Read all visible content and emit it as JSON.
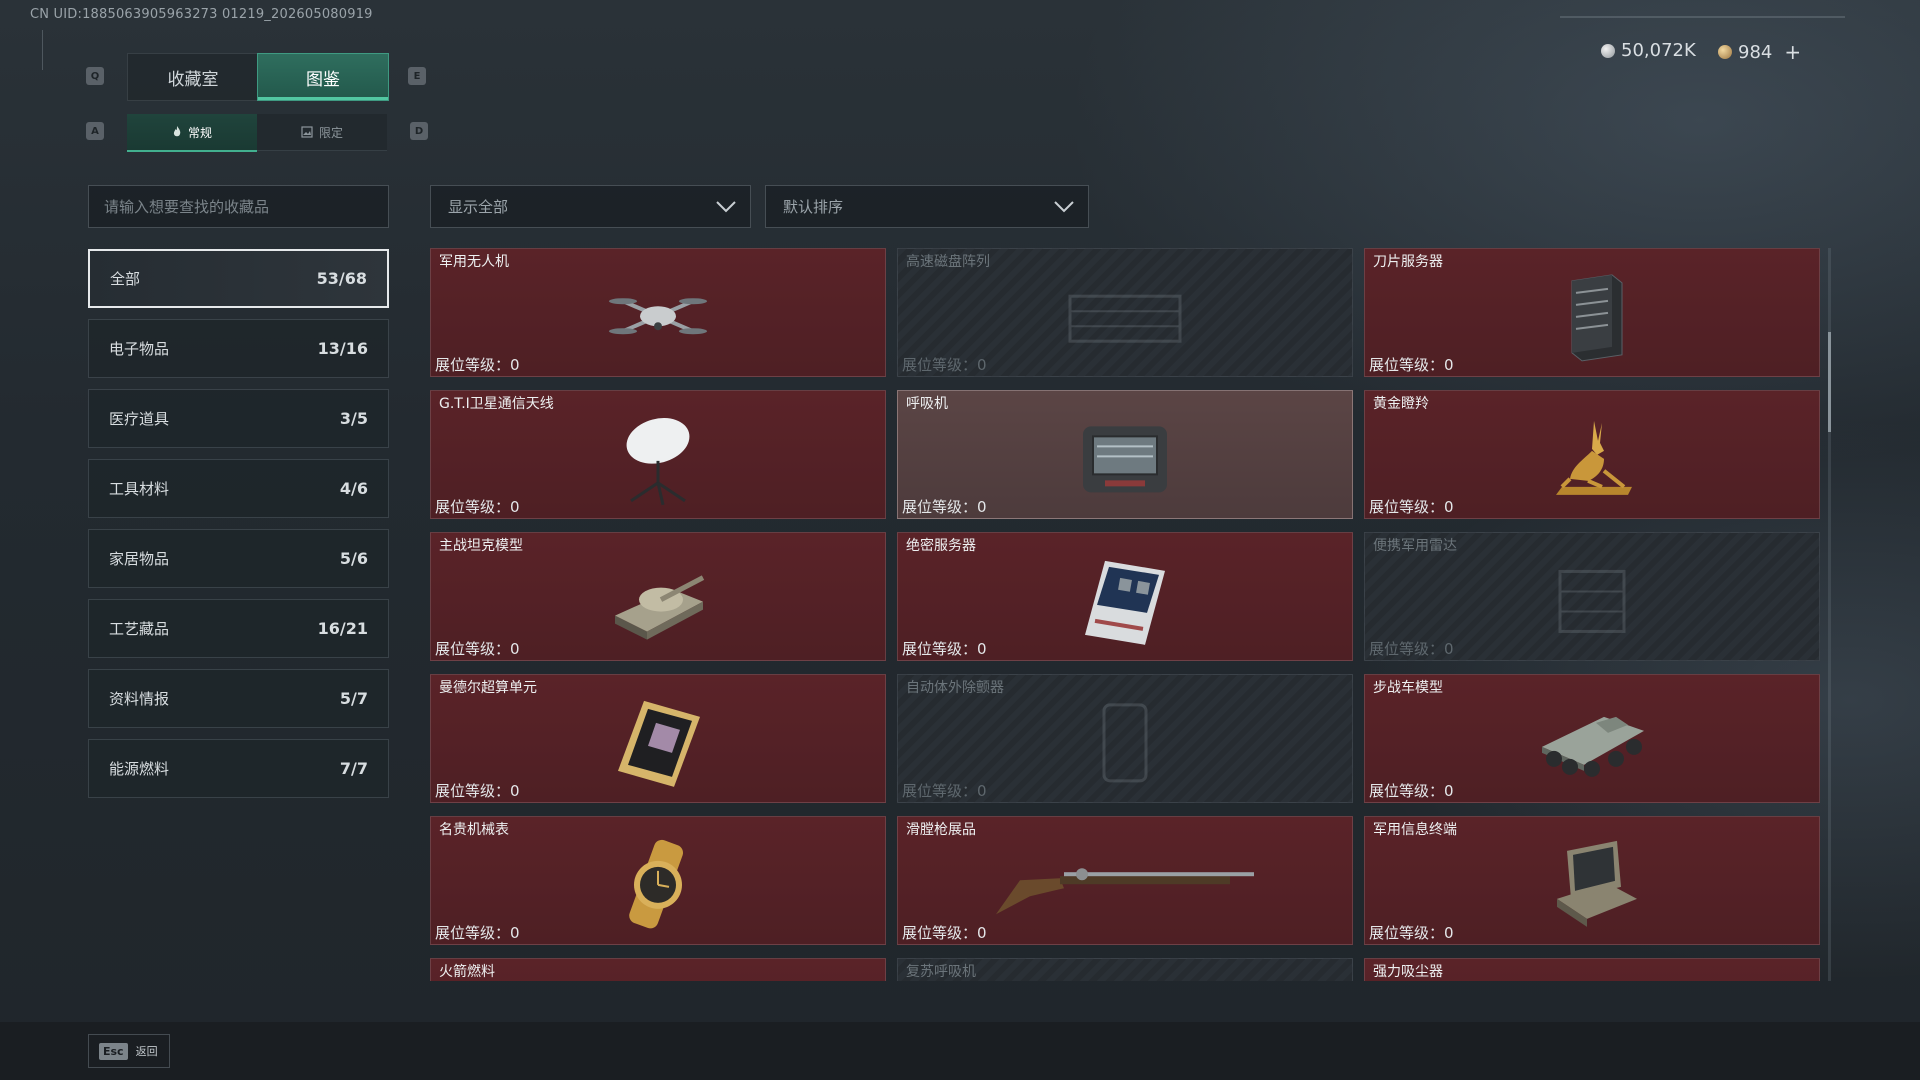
{
  "uid_text": "CN UID:1885063905963273 01219_202605080919",
  "currency": {
    "silver": "50,072K",
    "gold": "984",
    "plus": "+"
  },
  "keys": {
    "q": "Q",
    "e": "E",
    "a": "A",
    "d": "D"
  },
  "tabs": {
    "collection_room": "收藏室",
    "catalog": "图鉴"
  },
  "subtabs": {
    "regular": "常规",
    "limited": "限定"
  },
  "search": {
    "placeholder": "请输入想要查找的收藏品"
  },
  "filters": {
    "show": "显示全部",
    "sort": "默认排序"
  },
  "categories": [
    {
      "name": "全部",
      "count": "53/68"
    },
    {
      "name": "电子物品",
      "count": "13/16"
    },
    {
      "name": "医疗道具",
      "count": "3/5"
    },
    {
      "name": "工具材料",
      "count": "4/6"
    },
    {
      "name": "家居物品",
      "count": "5/6"
    },
    {
      "name": "工艺藏品",
      "count": "16/21"
    },
    {
      "name": "资料情报",
      "count": "5/7"
    },
    {
      "name": "能源燃料",
      "count": "7/7"
    }
  ],
  "level_label": "展位等级：0",
  "items": [
    {
      "name": "军用无人机",
      "state": "owned",
      "icon": "drone-icon"
    },
    {
      "name": "高速磁盘阵列",
      "state": "locked",
      "icon": "disk-array-icon"
    },
    {
      "name": "刀片服务器",
      "state": "owned",
      "icon": "blade-server-icon"
    },
    {
      "name": "G.T.I卫星通信天线",
      "state": "owned",
      "icon": "satellite-dish-icon"
    },
    {
      "name": "呼吸机",
      "state": "highlight",
      "icon": "ventilator-icon"
    },
    {
      "name": "黄金瞪羚",
      "state": "owned",
      "icon": "golden-gazelle-icon"
    },
    {
      "name": "主战坦克模型",
      "state": "owned",
      "icon": "tank-icon"
    },
    {
      "name": "绝密服务器",
      "state": "owned",
      "icon": "secret-server-icon"
    },
    {
      "name": "便携军用雷达",
      "state": "locked",
      "icon": "radar-icon"
    },
    {
      "name": "曼德尔超算单元",
      "state": "owned",
      "icon": "supercomputer-chip-icon"
    },
    {
      "name": "自动体外除颤器",
      "state": "locked",
      "icon": "defibrillator-icon"
    },
    {
      "name": "步战车模型",
      "state": "owned",
      "icon": "ifv-icon"
    },
    {
      "name": "名贵机械表",
      "state": "owned",
      "icon": "watch-icon"
    },
    {
      "name": "滑膛枪展品",
      "state": "owned",
      "icon": "musket-icon"
    },
    {
      "name": "军用信息终端",
      "state": "owned",
      "icon": "field-terminal-icon"
    },
    {
      "name": "火箭燃料",
      "state": "owned",
      "icon": "rocket-fuel-icon"
    },
    {
      "name": "复苏呼吸机",
      "state": "locked",
      "icon": "resuscitator-icon"
    },
    {
      "name": "强力吸尘器",
      "state": "owned",
      "icon": "vacuum-icon"
    }
  ],
  "esc": {
    "key": "Esc",
    "label": "返回"
  }
}
